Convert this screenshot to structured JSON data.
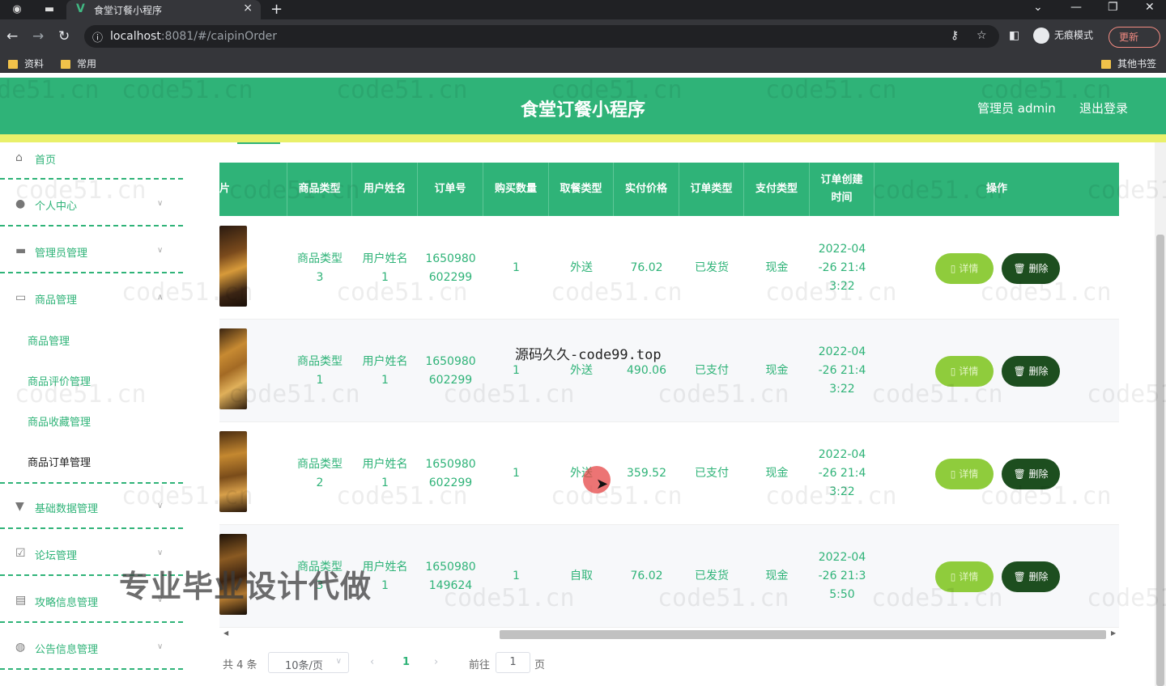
{
  "browser": {
    "tab_title": "食堂订餐小程序",
    "url_host": "localhost",
    "url_path": ":8081/#/caipinOrder",
    "incognito_label": "无痕模式",
    "update_label": "更新",
    "bookmarks": [
      "资料",
      "常用"
    ],
    "other_bookmarks": "其他书签"
  },
  "header": {
    "title": "食堂订餐小程序",
    "admin": "管理员 admin",
    "logout": "退出登录"
  },
  "sidebar": {
    "items": [
      {
        "label": "首页",
        "icon": "home-icon"
      },
      {
        "label": "个人中心",
        "icon": "user-icon"
      },
      {
        "label": "管理员管理",
        "icon": "admin-icon"
      },
      {
        "label": "商品管理",
        "icon": "chat-icon"
      },
      {
        "label": "基础数据管理",
        "icon": "data-icon"
      },
      {
        "label": "论坛管理",
        "icon": "forum-icon"
      },
      {
        "label": "攻略信息管理",
        "icon": "doc-icon"
      },
      {
        "label": "公告信息管理",
        "icon": "notice-icon"
      }
    ],
    "submenu": [
      "商品管理",
      "商品评价管理",
      "商品收藏管理",
      "商品订单管理"
    ]
  },
  "table": {
    "headers": [
      "片",
      "商品类型",
      "用户姓名",
      "订单号",
      "购买数量",
      "取餐类型",
      "实付价格",
      "订单类型",
      "支付类型",
      "订单创建\n时间",
      "操作"
    ],
    "rows": [
      {
        "type": "商品类型\n3",
        "user": "用户姓名\n1",
        "order_no": "1650980\n602299",
        "qty": "1",
        "pickup": "外送",
        "price": "76.02",
        "order_type": "已发货",
        "pay": "现金",
        "created": "2022-04\n-26 21:4\n3:22"
      },
      {
        "type": "商品类型\n1",
        "user": "用户姓名\n1",
        "order_no": "1650980\n602299",
        "qty": "1",
        "pickup": "外送",
        "price": "490.06",
        "order_type": "已支付",
        "pay": "现金",
        "created": "2022-04\n-26 21:4\n3:22"
      },
      {
        "type": "商品类型\n2",
        "user": "用户姓名\n1",
        "order_no": "1650980\n602299",
        "qty": "1",
        "pickup": "外送",
        "price": "359.52",
        "order_type": "已支付",
        "pay": "现金",
        "created": "2022-04\n-26 21:4\n3:22"
      },
      {
        "type": "商品类型\n3",
        "user": "用户姓名\n1",
        "order_no": "1650980\n149624",
        "qty": "1",
        "pickup": "自取",
        "price": "76.02",
        "order_type": "已发货",
        "pay": "现金",
        "created": "2022-04\n-26 21:3\n5:50"
      }
    ],
    "detail_label": "详情",
    "delete_label": "删除"
  },
  "pagination": {
    "total": "共 4 条",
    "page_size": "10条/页",
    "current": "1",
    "goto_label": "前往",
    "goto_value": "1",
    "page_unit": "页"
  },
  "overlays": {
    "watermark": "code51.cn",
    "center_text": "源码久久-code99.top",
    "big_text": "专业毕业设计代做"
  }
}
